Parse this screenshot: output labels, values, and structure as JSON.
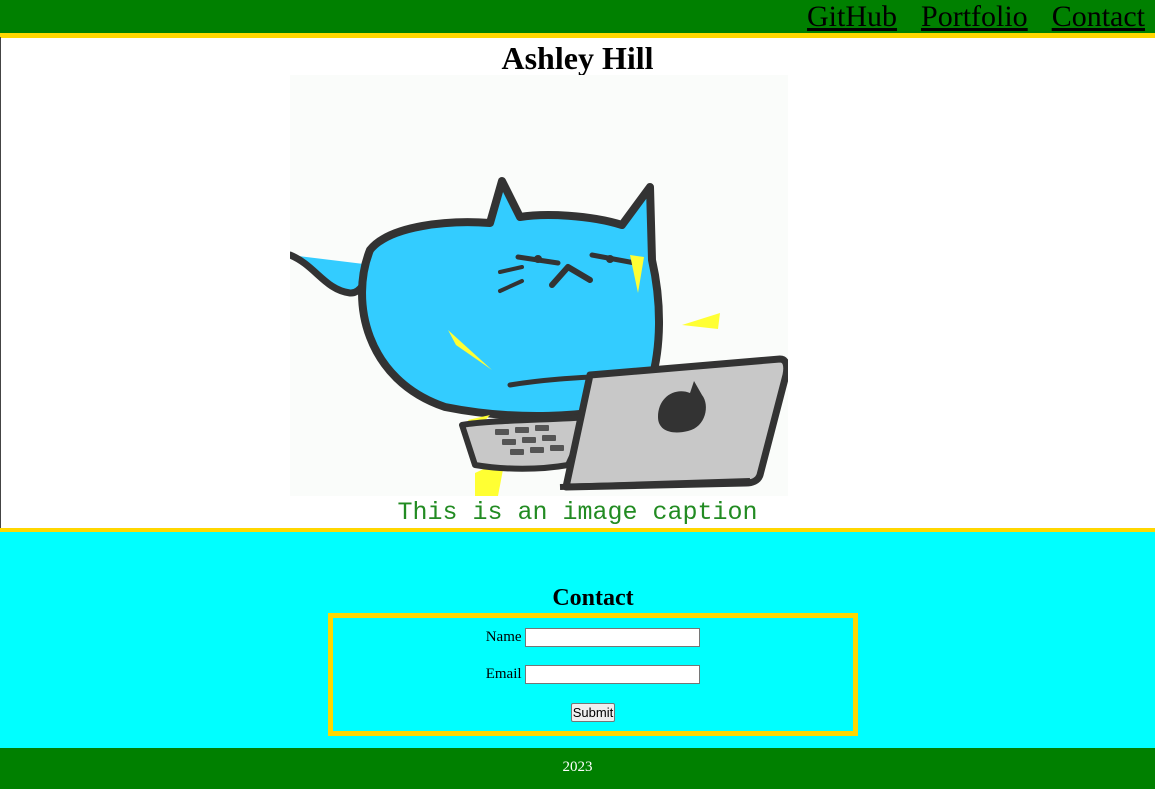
{
  "nav": {
    "links": [
      {
        "label": "GitHub"
      },
      {
        "label": "Portfolio"
      },
      {
        "label": "Contact"
      }
    ]
  },
  "hero": {
    "title": "Ashley Hill",
    "image_caption": "This is an image caption"
  },
  "contact": {
    "title": "Contact",
    "name_label": "Name",
    "name_value": "",
    "email_label": "Email",
    "email_value": "",
    "submit_label": "Submit"
  },
  "footer": {
    "text": "2023"
  },
  "colors": {
    "nav_bg": "#008000",
    "accent_border": "#ffd700",
    "contact_bg": "#00ffff",
    "caption_text": "#228b22",
    "cat_blue": "#33ccff",
    "laptop_gray": "#c8c8c8",
    "spark_yellow": "#ffff33"
  }
}
